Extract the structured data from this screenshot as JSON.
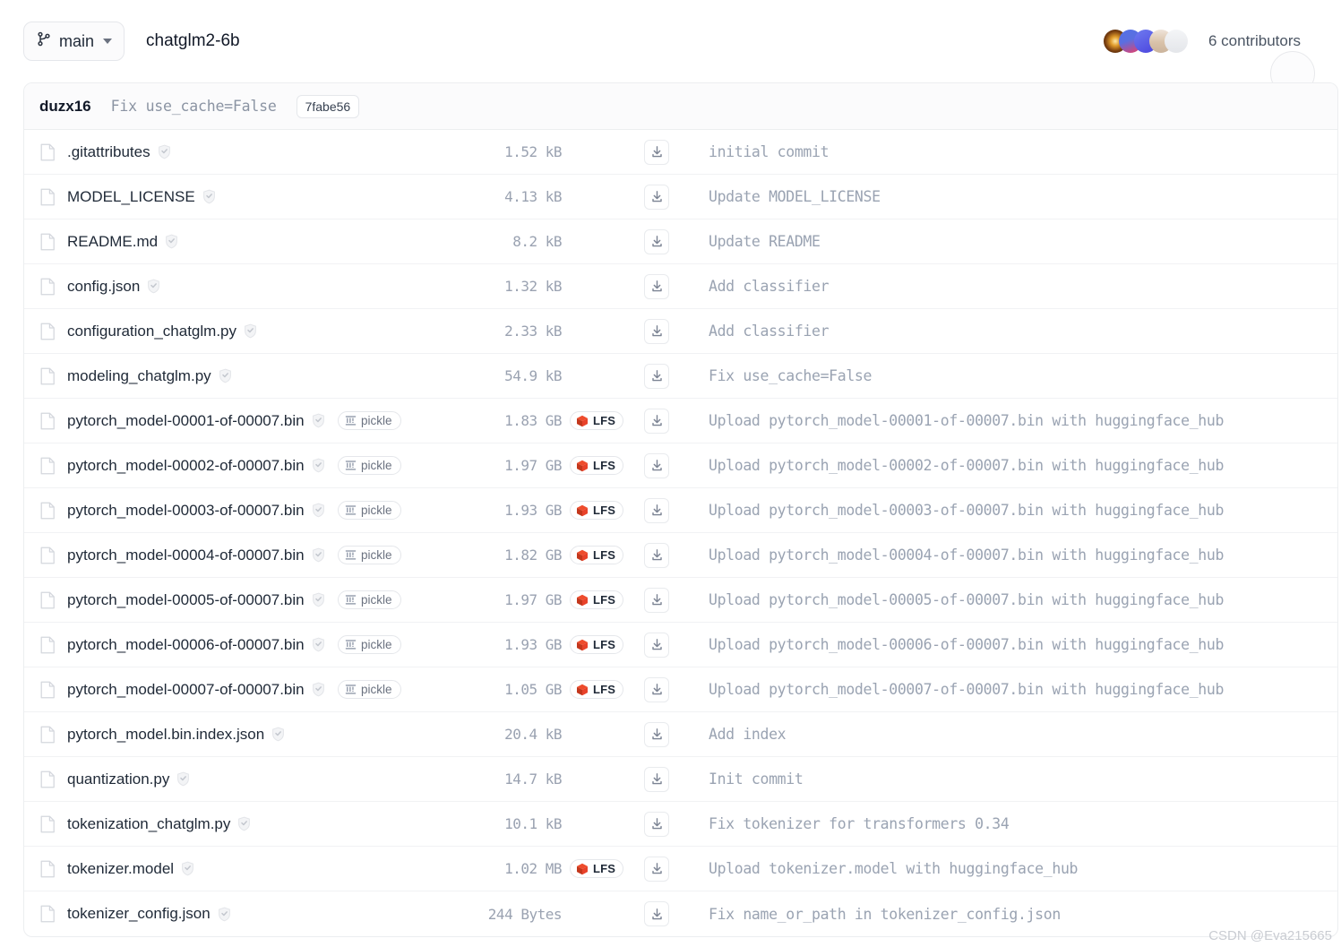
{
  "header": {
    "branch": "main",
    "repo_title": "chatglm2-6b",
    "contributors_label": "6 contributors",
    "avatar_colors": [
      "#3a1f0d",
      "#4a5fe0",
      "#4f55e8",
      "#d8c3ae",
      "#e9eaee"
    ]
  },
  "commit_bar": {
    "author": "duzx16",
    "message": "Fix use_cache=False",
    "sha": "7fabe56"
  },
  "badges": {
    "pickle_label": "pickle",
    "lfs_label": "LFS",
    "lfs_color": "#ee4c2c"
  },
  "files": [
    {
      "name": ".gitattributes",
      "pickle": false,
      "size": "1.52 kB",
      "lfs": false,
      "commit": "initial commit"
    },
    {
      "name": "MODEL_LICENSE",
      "pickle": false,
      "size": "4.13 kB",
      "lfs": false,
      "commit": "Update MODEL_LICENSE"
    },
    {
      "name": "README.md",
      "pickle": false,
      "size": "8.2 kB",
      "lfs": false,
      "commit": "Update README"
    },
    {
      "name": "config.json",
      "pickle": false,
      "size": "1.32 kB",
      "lfs": false,
      "commit": "Add classifier"
    },
    {
      "name": "configuration_chatglm.py",
      "pickle": false,
      "size": "2.33 kB",
      "lfs": false,
      "commit": "Add classifier"
    },
    {
      "name": "modeling_chatglm.py",
      "pickle": false,
      "size": "54.9 kB",
      "lfs": false,
      "commit": "Fix use_cache=False"
    },
    {
      "name": "pytorch_model-00001-of-00007.bin",
      "pickle": true,
      "size": "1.83 GB",
      "lfs": true,
      "commit": "Upload pytorch_model-00001-of-00007.bin with huggingface_hub"
    },
    {
      "name": "pytorch_model-00002-of-00007.bin",
      "pickle": true,
      "size": "1.97 GB",
      "lfs": true,
      "commit": "Upload pytorch_model-00002-of-00007.bin with huggingface_hub"
    },
    {
      "name": "pytorch_model-00003-of-00007.bin",
      "pickle": true,
      "size": "1.93 GB",
      "lfs": true,
      "commit": "Upload pytorch_model-00003-of-00007.bin with huggingface_hub"
    },
    {
      "name": "pytorch_model-00004-of-00007.bin",
      "pickle": true,
      "size": "1.82 GB",
      "lfs": true,
      "commit": "Upload pytorch_model-00004-of-00007.bin with huggingface_hub"
    },
    {
      "name": "pytorch_model-00005-of-00007.bin",
      "pickle": true,
      "size": "1.97 GB",
      "lfs": true,
      "commit": "Upload pytorch_model-00005-of-00007.bin with huggingface_hub"
    },
    {
      "name": "pytorch_model-00006-of-00007.bin",
      "pickle": true,
      "size": "1.93 GB",
      "lfs": true,
      "commit": "Upload pytorch_model-00006-of-00007.bin with huggingface_hub"
    },
    {
      "name": "pytorch_model-00007-of-00007.bin",
      "pickle": true,
      "size": "1.05 GB",
      "lfs": true,
      "commit": "Upload pytorch_model-00007-of-00007.bin with huggingface_hub"
    },
    {
      "name": "pytorch_model.bin.index.json",
      "pickle": false,
      "size": "20.4 kB",
      "lfs": false,
      "commit": "Add index"
    },
    {
      "name": "quantization.py",
      "pickle": false,
      "size": "14.7 kB",
      "lfs": false,
      "commit": "Init commit"
    },
    {
      "name": "tokenization_chatglm.py",
      "pickle": false,
      "size": "10.1 kB",
      "lfs": false,
      "commit": "Fix tokenizer for transformers 0.34"
    },
    {
      "name": "tokenizer.model",
      "pickle": false,
      "size": "1.02 MB",
      "lfs": true,
      "commit": "Upload tokenizer.model with huggingface_hub"
    },
    {
      "name": "tokenizer_config.json",
      "pickle": false,
      "size": "244 Bytes",
      "lfs": false,
      "commit": "Fix name_or_path in tokenizer_config.json"
    }
  ],
  "watermark": "CSDN @Eva215665"
}
